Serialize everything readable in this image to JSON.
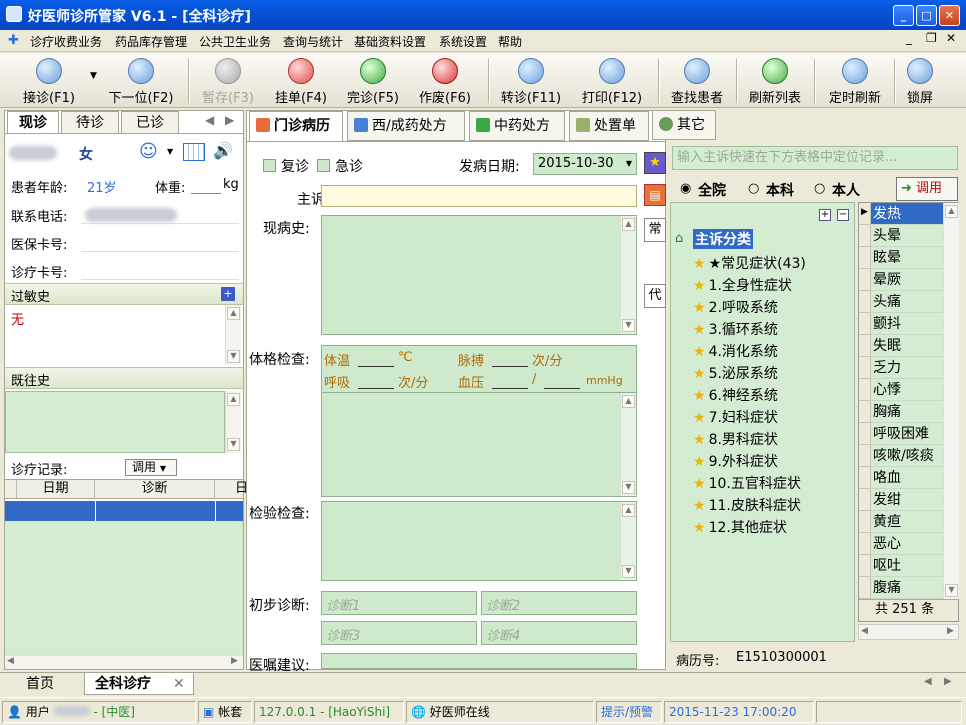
{
  "window": {
    "title": "好医师诊所管家 V6.1 - [全科诊疗]"
  },
  "menu": [
    "诊疗收费业务",
    "药品库存管理",
    "公共卫生业务",
    "查询与统计",
    "基础资料设置",
    "系统设置",
    "帮助"
  ],
  "toolbar": {
    "buttons": [
      {
        "label": "接诊(F1)",
        "icon": "reception-icon"
      },
      {
        "label": "下一位(F2)",
        "icon": "next-patient-icon"
      },
      {
        "label": "暂存(F3)",
        "icon": "save-temp-icon",
        "disabled": true
      },
      {
        "label": "挂单(F4)",
        "icon": "hang-order-icon"
      },
      {
        "label": "完诊(F5)",
        "icon": "complete-icon"
      },
      {
        "label": "作废(F6)",
        "icon": "void-icon"
      },
      {
        "label": "转诊(F11)",
        "icon": "transfer-icon"
      },
      {
        "label": "打印(F12)",
        "icon": "print-icon"
      },
      {
        "label": "查找患者",
        "icon": "find-patient-icon"
      },
      {
        "label": "刷新列表",
        "icon": "refresh-icon"
      },
      {
        "label": "定时刷新",
        "icon": "timer-refresh-icon"
      },
      {
        "label": "锁屏",
        "icon": "lock-screen-icon"
      }
    ]
  },
  "left": {
    "tabs": [
      "现诊",
      "待诊",
      "已诊"
    ],
    "gender": "女",
    "age_label": "患者年龄:",
    "age_value": "21岁",
    "weight_label": "体重:",
    "weight_unit": "kg",
    "phone_label": "联系电话:",
    "insurance_label": "医保卡号:",
    "card_label": "诊疗卡号:",
    "allergy_title": "过敏史",
    "allergy_value": "无",
    "history_title": "既往史",
    "records_label": "诊疗记录:",
    "records_btn": "调用",
    "table_headers": [
      "日期",
      "诊断",
      "日"
    ]
  },
  "main": {
    "tabs": [
      "门诊病历",
      "西/成药处方",
      "中药处方",
      "处置单",
      "其它"
    ],
    "revisit": "复诊",
    "emergency": "急诊",
    "onset_label": "发病日期:",
    "onset_date": "2015-10-30",
    "complaint_label": "主诉:",
    "present_label": "现病史:",
    "exam_label": "体格检查:",
    "vitals": {
      "temp": "体温",
      "temp_unit": "℃",
      "pulse": "脉搏",
      "pulse_unit": "次/分",
      "resp": "呼吸",
      "resp_unit": "次/分",
      "bp": "血压",
      "bp_sep": "/",
      "bp_unit": "mmHg"
    },
    "lab_label": "检验检查:",
    "diag_label": "初步诊断:",
    "diag_placeholders": [
      "诊断1",
      "诊断2",
      "诊断3",
      "诊断4"
    ],
    "advice_label": "医嘱建议:",
    "side_buttons": [
      "常",
      "代"
    ]
  },
  "right": {
    "search_placeholder": "输入主诉快速在下方表格中定位记录...",
    "scope": [
      "全院",
      "本科",
      "本人"
    ],
    "use_btn": "调用",
    "tree_root": "主诉分类",
    "tree_items": [
      "★常见症状(43)",
      "1.全身性症状",
      "2.呼吸系统",
      "3.循环系统",
      "4.消化系统",
      "5.泌尿系统",
      "6.神经系统",
      "7.妇科症状",
      "8.男科症状",
      "9.外科症状",
      "10.五官科症状",
      "11.皮肤科症状",
      "12.其他症状"
    ],
    "symptoms": [
      "发热",
      "头晕",
      "眩晕",
      "晕厥",
      "头痛",
      "颤抖",
      "失眠",
      "乏力",
      "心悸",
      "胸痛",
      "呼吸困难",
      "咳嗽/咳痰",
      "咯血",
      "发绀",
      "黄疸",
      "恶心",
      "呕吐",
      "腹痛"
    ],
    "total": "共 251 条",
    "record_label": "病历号:",
    "record_value": "E1510300001"
  },
  "bottom_tabs": [
    "首页",
    "全科诊疗"
  ],
  "status": {
    "user_label": "用户",
    "dept": "- [中医]",
    "account": "帐套",
    "server": "127.0.0.1 - [HaoYiShi]",
    "online": "好医师在线",
    "tips": "提示/预警",
    "datetime": "2015-11-23 17:00:20"
  }
}
